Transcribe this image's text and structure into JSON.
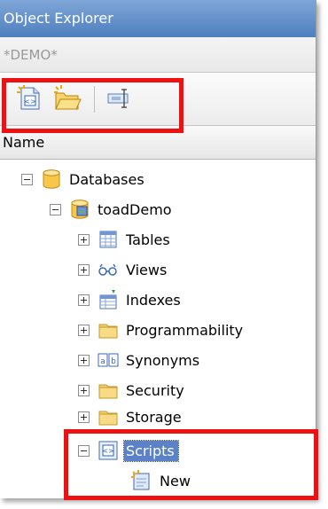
{
  "panel": {
    "title": "Object Explorer",
    "connection": "*DEMO*"
  },
  "toolbar": {
    "buttons": [
      {
        "icon": "new-script-icon"
      },
      {
        "icon": "open-folder-icon"
      },
      {
        "icon": "properties-icon"
      }
    ]
  },
  "columns": {
    "name": "Name"
  },
  "tree": {
    "databases": "Databases",
    "database": "toadDemo",
    "children": [
      "Tables",
      "Views",
      "Indexes",
      "Programmability",
      "Synonyms",
      "Security",
      "Storage"
    ],
    "scripts": "Scripts",
    "new": "New"
  },
  "colors": {
    "title_bar": "#5f8dca",
    "selection": "#5b82c9",
    "highlight": "#ee1111"
  }
}
